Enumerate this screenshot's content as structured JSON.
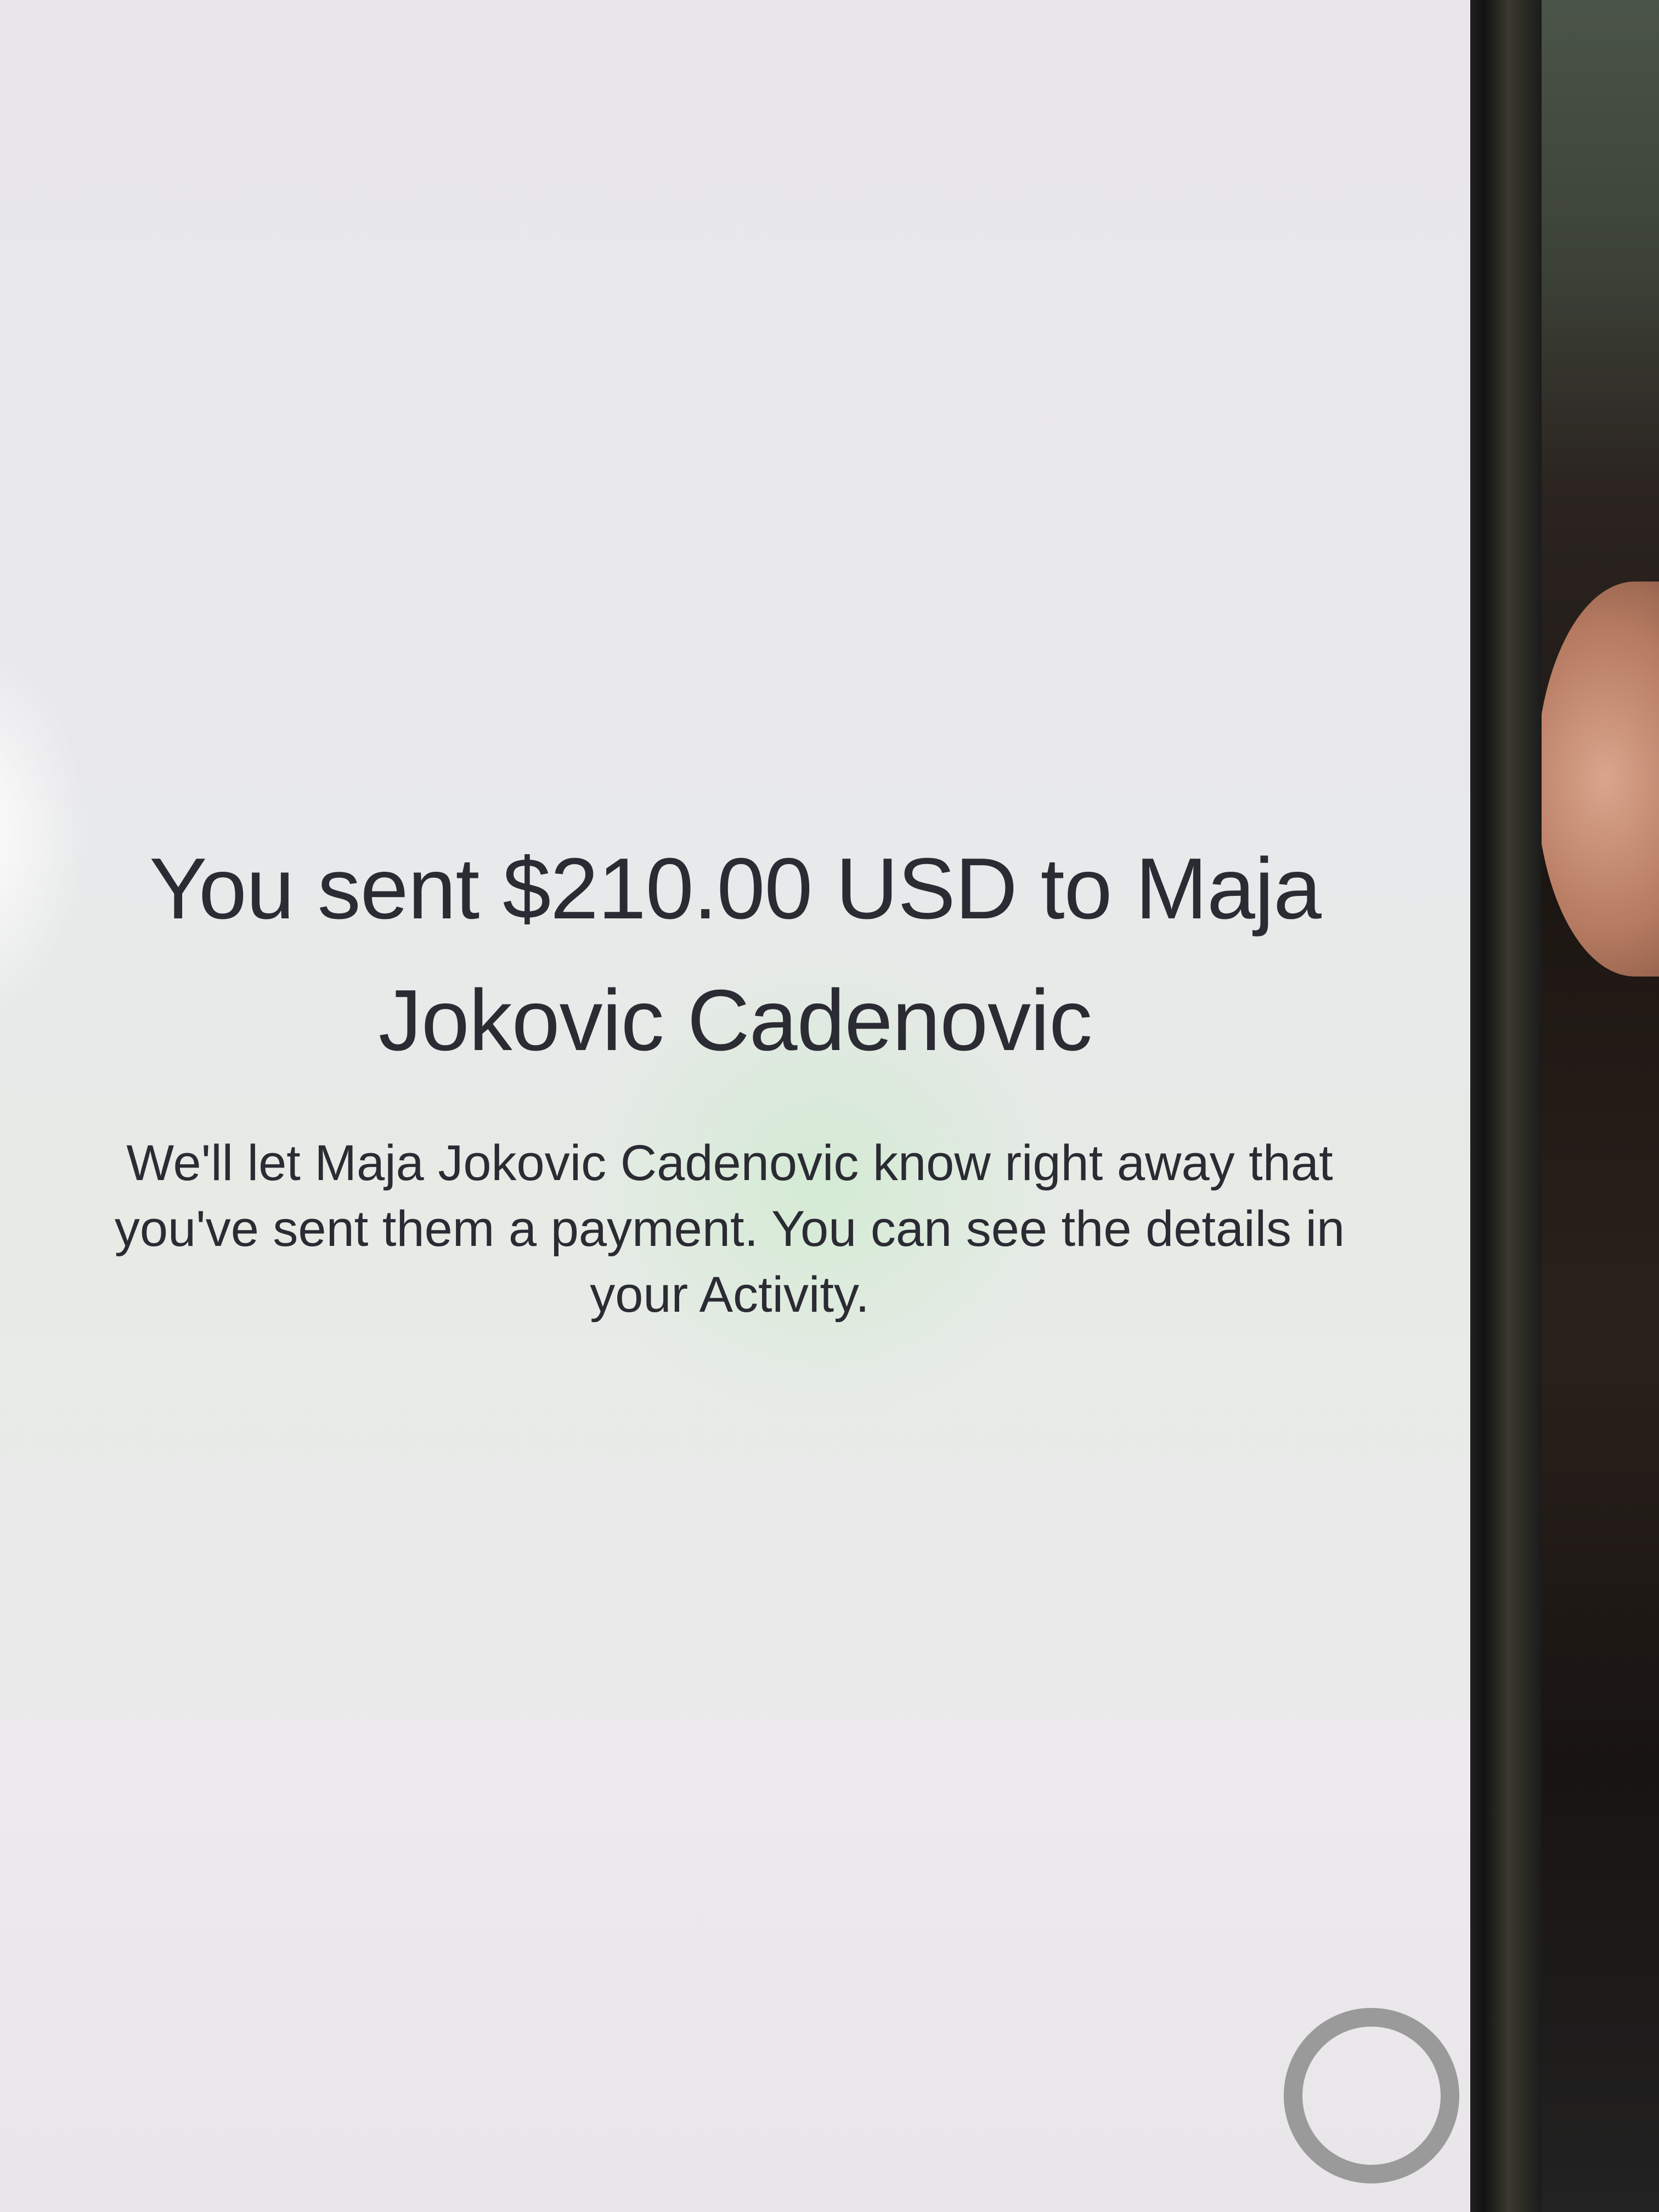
{
  "confirmation": {
    "title": "You sent $210.00 USD to Maja Jokovic Cadenovic",
    "message": "We'll let Maja Jokovic Cadenovic know right away that you've sent them a payment. You can see the details in your Activity."
  },
  "icons": {
    "floating_button": "circle-ring-icon"
  },
  "colors": {
    "text": "#2b2b33",
    "background": "#e9e8ec"
  }
}
